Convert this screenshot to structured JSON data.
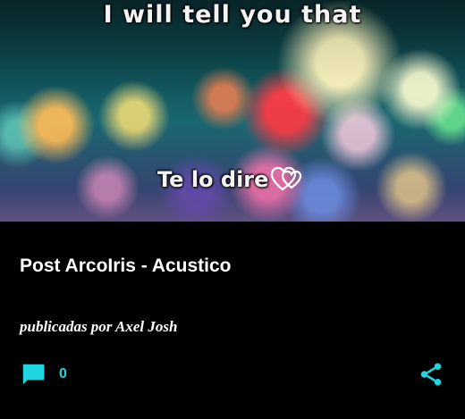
{
  "hero": {
    "line1": "I will tell you that",
    "line2": "Te lo dire",
    "hearts_icon": "double-heart-icon"
  },
  "post": {
    "title": "Post ArcoIris - Acustico",
    "byline": "publicadas por Axel Josh"
  },
  "actions": {
    "comment_icon": "comment-icon",
    "comment_count": "0",
    "share_icon": "share-icon",
    "accent_color": "#1fd6e0"
  },
  "colors": {
    "background": "#000000",
    "text": "#ffffff",
    "accent": "#1fd6e0"
  }
}
